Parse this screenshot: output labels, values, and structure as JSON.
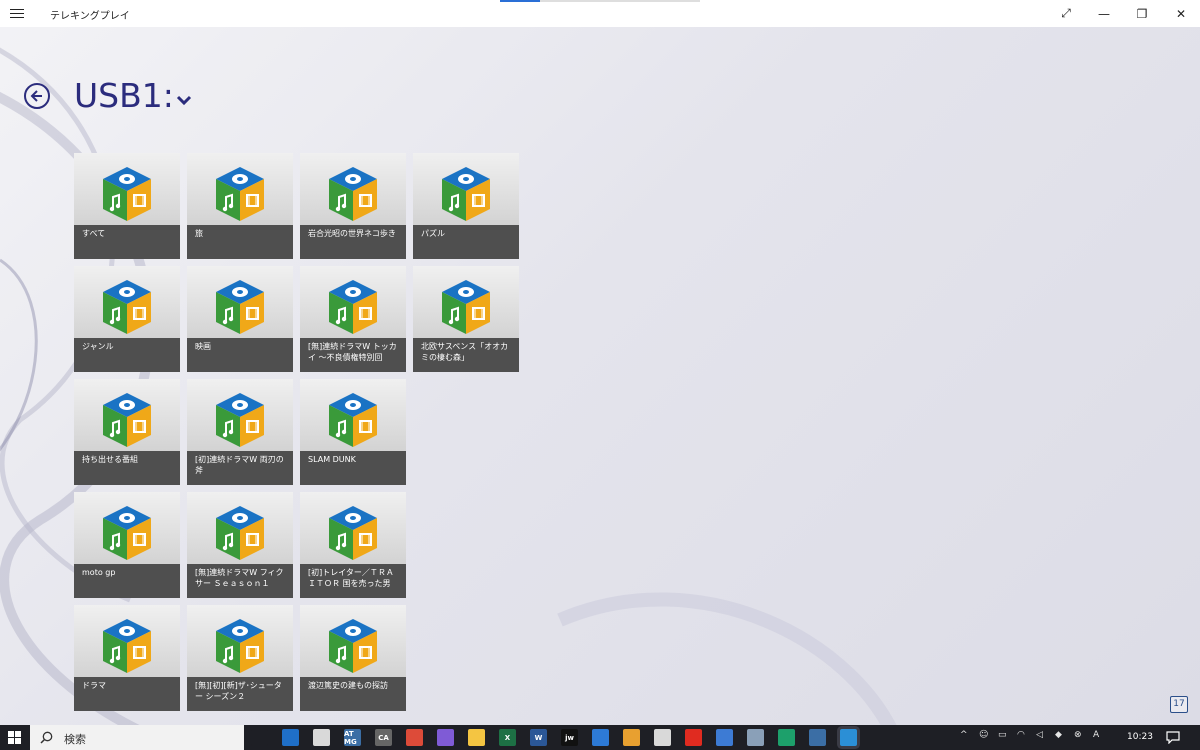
{
  "window": {
    "title": "テレキングプレイ",
    "progress": 0.2,
    "controls": [
      "expand-icon",
      "minimize-icon",
      "restore-icon",
      "close-icon"
    ]
  },
  "header": {
    "back_icon": "back-arrow-circle-icon",
    "title": "USB1:",
    "dropdown_icon": "chevron-down-icon"
  },
  "tiles": [
    {
      "label": "すべて"
    },
    {
      "label": "旅"
    },
    {
      "label": "岩合光昭の世界ネコ歩き"
    },
    {
      "label": "パズル"
    },
    {
      "label": "ジャンル"
    },
    {
      "label": "映画"
    },
    {
      "label": "[無]連続ドラマW トッカイ ～不良債権特別回"
    },
    {
      "label": "北欧サスペンス「オオカミの棲む森」"
    },
    {
      "label": "持ち出せる番組"
    },
    {
      "label": "[初]連続ドラマW 両刃の斧"
    },
    {
      "label": "SLAM DUNK"
    },
    {
      "label": "moto gp"
    },
    {
      "label": "[無]連続ドラマW フィクサー Ｓｅａｓｏｎ１"
    },
    {
      "label": "[初]トレイター／ＴＲＡＩＴＯＲ 国を売った男"
    },
    {
      "label": "ドラマ"
    },
    {
      "label": "[無][初][新]ザ･シューター シーズン２"
    },
    {
      "label": "渡辺篤史の建もの探訪"
    }
  ],
  "badge": "17",
  "taskbar": {
    "start_icon": "windows-start-icon",
    "search_placeholder": "検索",
    "apps": [
      {
        "icon": "task-view-icon",
        "text": "",
        "color": "#1e1f25"
      },
      {
        "icon": "edge-blue-icon",
        "text": "",
        "color": "#1f6fc8"
      },
      {
        "icon": "app-icon",
        "text": "",
        "color": "#d9d9d9"
      },
      {
        "icon": "atmg-icon",
        "text": "AT MG",
        "color": "#3b6ea5"
      },
      {
        "icon": "ca-icon",
        "text": "CA",
        "color": "#666666"
      },
      {
        "icon": "chrome-icon",
        "text": "",
        "color": "#dd4b39"
      },
      {
        "icon": "app-icon",
        "text": "",
        "color": "#7f5bd6"
      },
      {
        "icon": "file-explorer-icon",
        "text": "",
        "color": "#f4c542"
      },
      {
        "icon": "excel-icon",
        "text": "X",
        "color": "#1d7044"
      },
      {
        "icon": "word-icon",
        "text": "W",
        "color": "#2b5797"
      },
      {
        "icon": "jw-icon",
        "text": "jw",
        "color": "#111111"
      },
      {
        "icon": "app-icon",
        "text": "",
        "color": "#2d7ad6"
      },
      {
        "icon": "app-icon",
        "text": "",
        "color": "#e8a030"
      },
      {
        "icon": "app-icon",
        "text": "",
        "color": "#d9d9d9"
      },
      {
        "icon": "pdf-icon",
        "text": "",
        "color": "#e02b20"
      },
      {
        "icon": "calculator-icon",
        "text": "",
        "color": "#3d7bd4"
      },
      {
        "icon": "app-icon",
        "text": "",
        "color": "#8aa0b8"
      },
      {
        "icon": "edge-icon",
        "text": "",
        "color": "#1da06b"
      },
      {
        "icon": "defender-icon",
        "text": "",
        "color": "#3b6ea5"
      },
      {
        "icon": "telekingplay-icon",
        "text": "",
        "color": "#2b8fd6"
      }
    ],
    "tray": [
      "chevron-up-icon",
      "people-icon",
      "network-icon",
      "wifi-icon",
      "volume-icon",
      "dropbox-icon",
      "close-circle-icon",
      "adobe-icon"
    ],
    "clock": "10:23",
    "notification_icon": "notification-icon"
  }
}
